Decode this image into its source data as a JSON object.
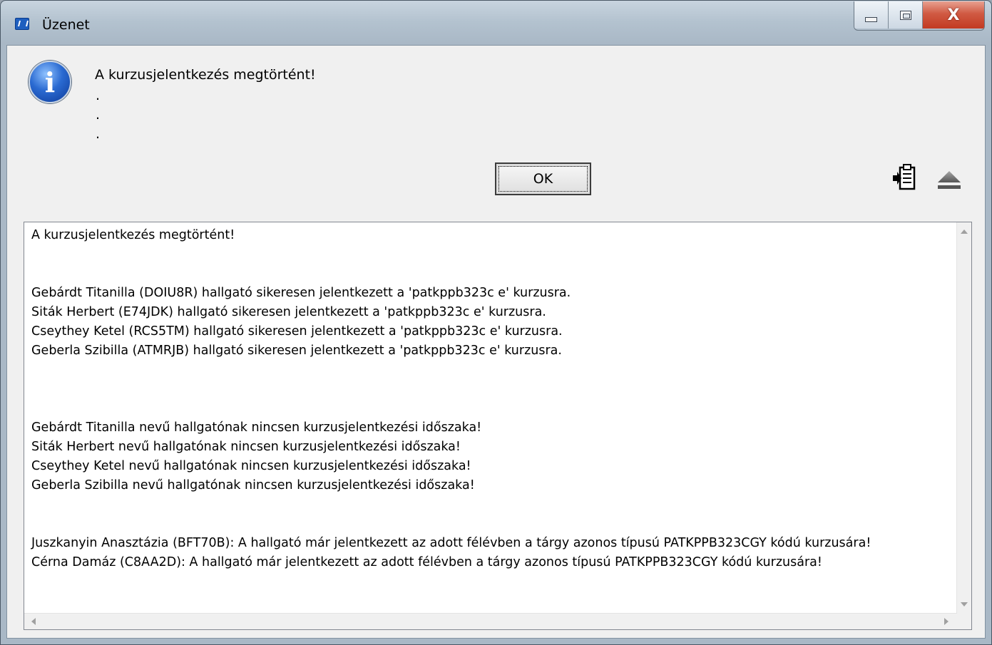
{
  "window": {
    "title": "Üzenet",
    "icon": "neptun-app-icon"
  },
  "caption_buttons": {
    "minimize_icon": "minimize-icon",
    "maximize_icon": "maximize-icon",
    "close_icon": "close-icon",
    "close_glyph": "X"
  },
  "message": {
    "icon": "info-icon",
    "icon_glyph": "i",
    "main_text": "A kurzusjelentkezés megtörtént!",
    "dots": [
      ".",
      ".",
      "."
    ]
  },
  "buttons": {
    "ok_label": "OK",
    "copy_icon": "copy-to-clipboard-icon",
    "collapse_icon": "collapse-details-icon"
  },
  "details": {
    "lines": [
      "A kurzusjelentkezés megtörtént!",
      "",
      "",
      "Gebárdt Titanilla (DOIU8R) hallgató sikeresen jelentkezett a 'patkppb323c e' kurzusra.",
      "Siták Herbert (E74JDK) hallgató sikeresen jelentkezett a 'patkppb323c e' kurzusra.",
      "Cseythey Ketel (RCS5TM) hallgató sikeresen jelentkezett a 'patkppb323c e' kurzusra.",
      "Geberla Szibilla (ATMRJB) hallgató sikeresen jelentkezett a 'patkppb323c e' kurzusra.",
      "",
      "",
      "",
      "Gebárdt Titanilla nevű hallgatónak nincsen kurzusjelentkezési időszaka!",
      "Siták Herbert nevű hallgatónak nincsen kurzusjelentkezési időszaka!",
      "Cseythey Ketel nevű hallgatónak nincsen kurzusjelentkezési időszaka!",
      "Geberla Szibilla nevű hallgatónak nincsen kurzusjelentkezési időszaka!",
      "",
      "",
      "Juszkanyin Anasztázia (BFT70B): A hallgató már jelentkezett az adott félévben a tárgy azonos típusú PATKPPB323CGY kódú kurzusára!",
      "Cérna Damáz (C8AA2D): A hallgató már jelentkezett az adott félévben a tárgy azonos típusú PATKPPB323CGY kódú kurzusára!"
    ]
  }
}
